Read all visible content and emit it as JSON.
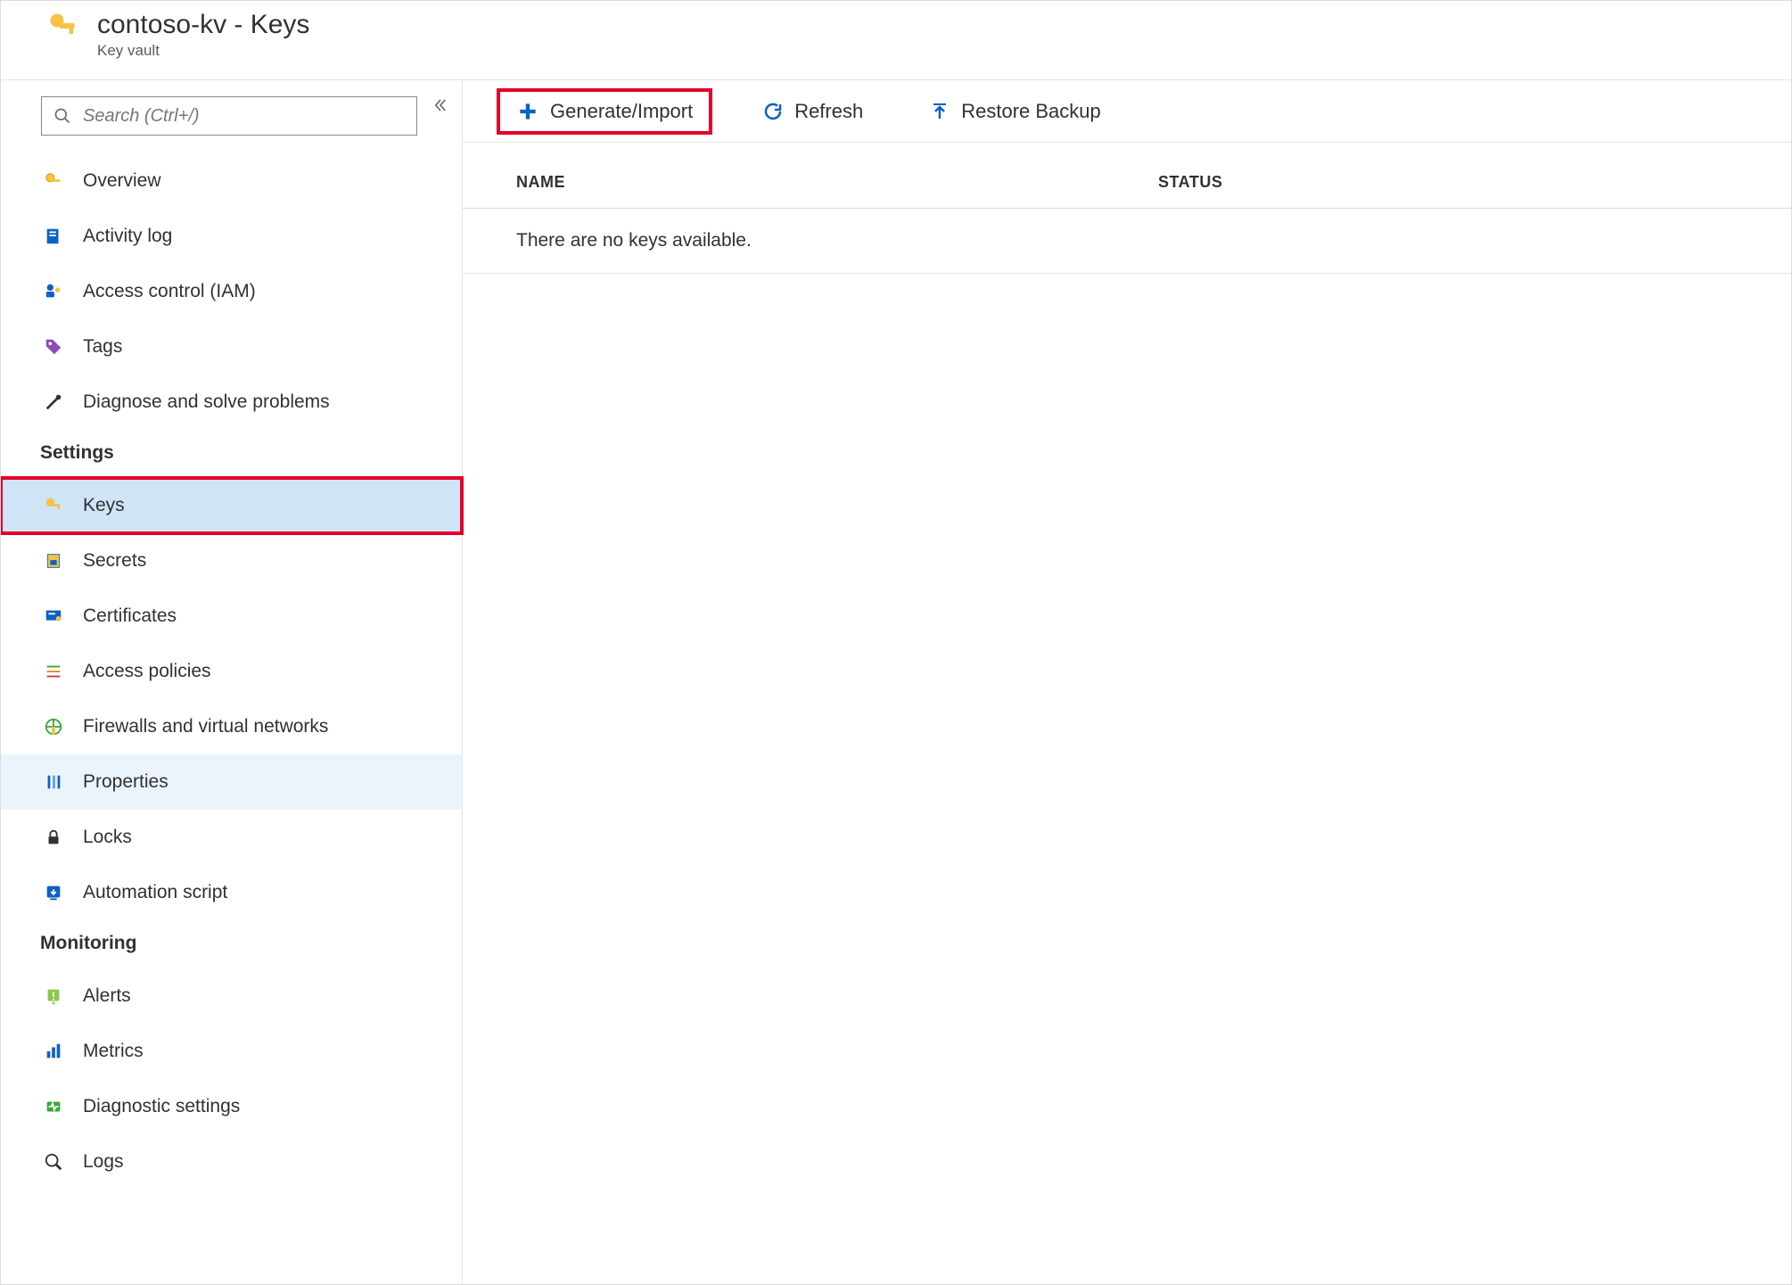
{
  "header": {
    "title": "contoso-kv - Keys",
    "subtitle": "Key vault"
  },
  "sidebar": {
    "search_placeholder": "Search (Ctrl+/)",
    "general": [
      {
        "label": "Overview",
        "icon": "key"
      },
      {
        "label": "Activity log",
        "icon": "log"
      },
      {
        "label": "Access control (IAM)",
        "icon": "iam"
      },
      {
        "label": "Tags",
        "icon": "tag"
      },
      {
        "label": "Diagnose and solve problems",
        "icon": "wrench"
      }
    ],
    "settings_heading": "Settings",
    "settings": [
      {
        "label": "Keys",
        "icon": "key",
        "selected": true
      },
      {
        "label": "Secrets",
        "icon": "secret"
      },
      {
        "label": "Certificates",
        "icon": "cert"
      },
      {
        "label": "Access policies",
        "icon": "policies"
      },
      {
        "label": "Firewalls and virtual networks",
        "icon": "firewall"
      },
      {
        "label": "Properties",
        "icon": "props",
        "hover": true
      },
      {
        "label": "Locks",
        "icon": "lock"
      },
      {
        "label": "Automation script",
        "icon": "automation"
      }
    ],
    "monitoring_heading": "Monitoring",
    "monitoring": [
      {
        "label": "Alerts",
        "icon": "alert"
      },
      {
        "label": "Metrics",
        "icon": "metrics"
      },
      {
        "label": "Diagnostic settings",
        "icon": "diag"
      },
      {
        "label": "Logs",
        "icon": "logs"
      }
    ]
  },
  "toolbar": {
    "generate": "Generate/Import",
    "refresh": "Refresh",
    "restore": "Restore Backup"
  },
  "table": {
    "col_name": "NAME",
    "col_status": "STATUS",
    "empty": "There are no keys available."
  }
}
